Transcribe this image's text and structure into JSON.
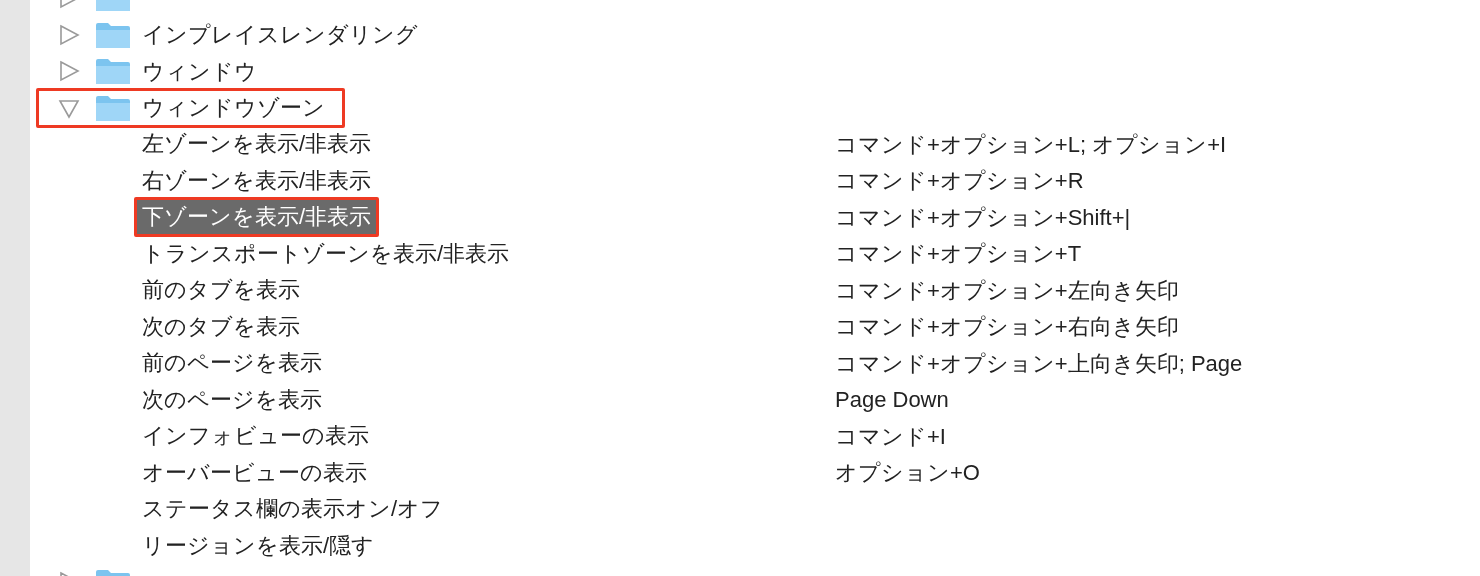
{
  "tree": [
    {
      "kind": "folder",
      "expanded": false,
      "outlined": false
    },
    {
      "kind": "folder",
      "label": "インプレイスレンダリング",
      "expanded": false,
      "outlined": false
    },
    {
      "kind": "folder",
      "label": "ウィンドウ",
      "expanded": false,
      "outlined": false
    },
    {
      "kind": "folder",
      "label": "ウィンドウゾーン",
      "expanded": true,
      "outlined": true,
      "children": [
        {
          "kind": "command",
          "label": "左ゾーンを表示/非表示",
          "shortcut": "コマンド+オプション+L; オプション+I",
          "selected": false,
          "outlined": false
        },
        {
          "kind": "command",
          "label": "右ゾーンを表示/非表示",
          "shortcut": "コマンド+オプション+R",
          "selected": false,
          "outlined": false
        },
        {
          "kind": "command",
          "label": "下ゾーンを表示/非表示",
          "shortcut": "コマンド+オプション+Shift+|",
          "selected": true,
          "outlined": true
        },
        {
          "kind": "command",
          "label": "トランスポートゾーンを表示/非表示",
          "shortcut": "コマンド+オプション+T",
          "selected": false,
          "outlined": false
        },
        {
          "kind": "command",
          "label": "前のタブを表示",
          "shortcut": "コマンド+オプション+左向き矢印",
          "selected": false,
          "outlined": false
        },
        {
          "kind": "command",
          "label": "次のタブを表示",
          "shortcut": "コマンド+オプション+右向き矢印",
          "selected": false,
          "outlined": false
        },
        {
          "kind": "command",
          "label": "前のページを表示",
          "shortcut": "コマンド+オプション+上向き矢印; Page",
          "selected": false,
          "outlined": false
        },
        {
          "kind": "command",
          "label": "次のページを表示",
          "shortcut": "Page Down",
          "selected": false,
          "outlined": false
        },
        {
          "kind": "command",
          "label": "インフォビューの表示",
          "shortcut": "コマンド+I",
          "selected": false,
          "outlined": false
        },
        {
          "kind": "command",
          "label": "オーバービューの表示",
          "shortcut": "オプション+O",
          "selected": false,
          "outlined": false
        },
        {
          "kind": "command",
          "label": "ステータス欄の表示オン/オフ",
          "selected": false,
          "outlined": false
        },
        {
          "kind": "command",
          "label": "リージョンを表示/隠す",
          "selected": false,
          "outlined": false
        }
      ]
    },
    {
      "kind": "folder",
      "expanded": false,
      "outlined": false
    }
  ]
}
